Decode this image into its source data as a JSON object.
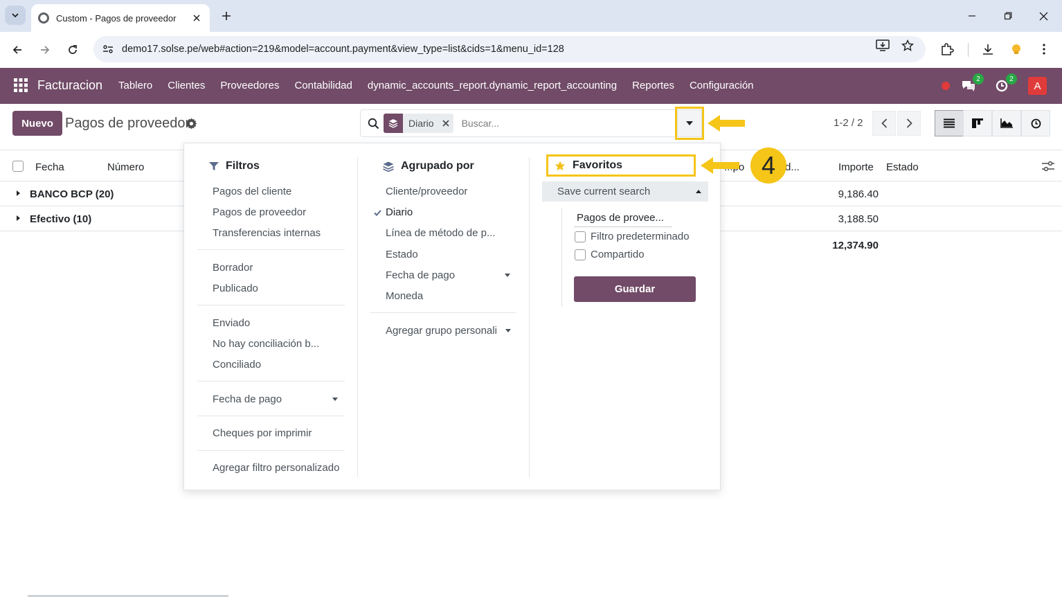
{
  "browser": {
    "tab_title": "Custom - Pagos de proveedor",
    "url": "demo17.solse.pe/web#action=219&model=account.payment&view_type=list&cids=1&menu_id=128"
  },
  "navbar": {
    "app_name": "Facturacion",
    "menu": [
      "Tablero",
      "Clientes",
      "Proveedores",
      "Contabilidad",
      "dynamic_accounts_report.dynamic_report_accounting",
      "Reportes",
      "Configuración"
    ],
    "messages_badge": "2",
    "activity_badge": "2",
    "avatar": "A",
    "colors": {
      "primary": "#714b67",
      "highlight": "#f5c518"
    }
  },
  "control_panel": {
    "new_button": "Nuevo",
    "title": "Pagos de proveedor",
    "facet_label": "Diario",
    "search_placeholder": "Buscar...",
    "pager": "1-2 / 2"
  },
  "list": {
    "headers": {
      "date": "Fecha",
      "number": "Número",
      "partial_a": "...po",
      "partial_b": "d...",
      "amount": "Importe",
      "status": "Estado"
    },
    "groups": [
      {
        "label": "BANCO BCP (20)",
        "amount": "9,186.40"
      },
      {
        "label": "Efectivo (10)",
        "amount": "3,188.50"
      }
    ],
    "total": "12,374.90"
  },
  "filters": {
    "title": "Filtros",
    "groups": [
      [
        "Pagos del cliente",
        "Pagos de proveedor",
        "Transferencias internas"
      ],
      [
        "Borrador",
        "Publicado"
      ],
      [
        "Enviado",
        "No hay conciliación b...",
        "Conciliado"
      ]
    ],
    "date_filter": "Fecha de pago",
    "checks": "Cheques por imprimir",
    "custom": "Agregar filtro personalizado"
  },
  "groupby": {
    "title": "Agrupado por",
    "items": [
      "Cliente/proveedor",
      "Diario",
      "Línea de método de p...",
      "Estado",
      "Fecha de pago",
      "Moneda"
    ],
    "custom": "Agregar grupo personali"
  },
  "favorites": {
    "title": "Favoritos",
    "save_current": "Save current search",
    "name_value": "Pagos de provee...",
    "default_filter": "Filtro predeterminado",
    "shared": "Compartido",
    "save_button": "Guardar"
  },
  "annotation": {
    "step": "4"
  }
}
